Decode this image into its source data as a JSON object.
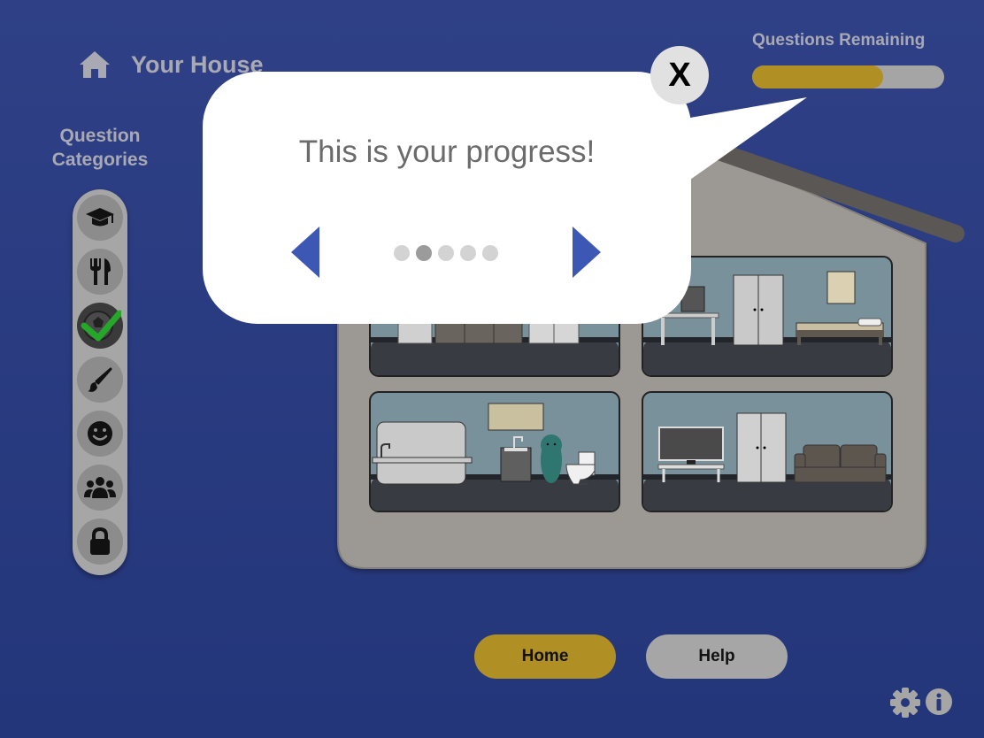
{
  "header": {
    "title": "Your House",
    "icon": "home-icon"
  },
  "sidebar": {
    "title": "Question Categories",
    "categories": [
      {
        "icon": "graduation-cap-icon"
      },
      {
        "icon": "fork-knife-icon"
      },
      {
        "icon": "soccer-ball-icon",
        "completed": true
      },
      {
        "icon": "paintbrush-icon"
      },
      {
        "icon": "smiley-icon"
      },
      {
        "icon": "people-icon"
      },
      {
        "icon": "lock-icon"
      }
    ]
  },
  "progress": {
    "label": "Questions Remaining",
    "value": 0.68
  },
  "tooltip": {
    "message": "This is your progress!",
    "close_label": "X",
    "pages": 5,
    "current_page": 2
  },
  "buttons": {
    "home": "Home",
    "help": "Help"
  },
  "colors": {
    "background": "#2b3d82",
    "accent_gold": "#b08f25",
    "arrow_blue": "#3d57b5"
  }
}
